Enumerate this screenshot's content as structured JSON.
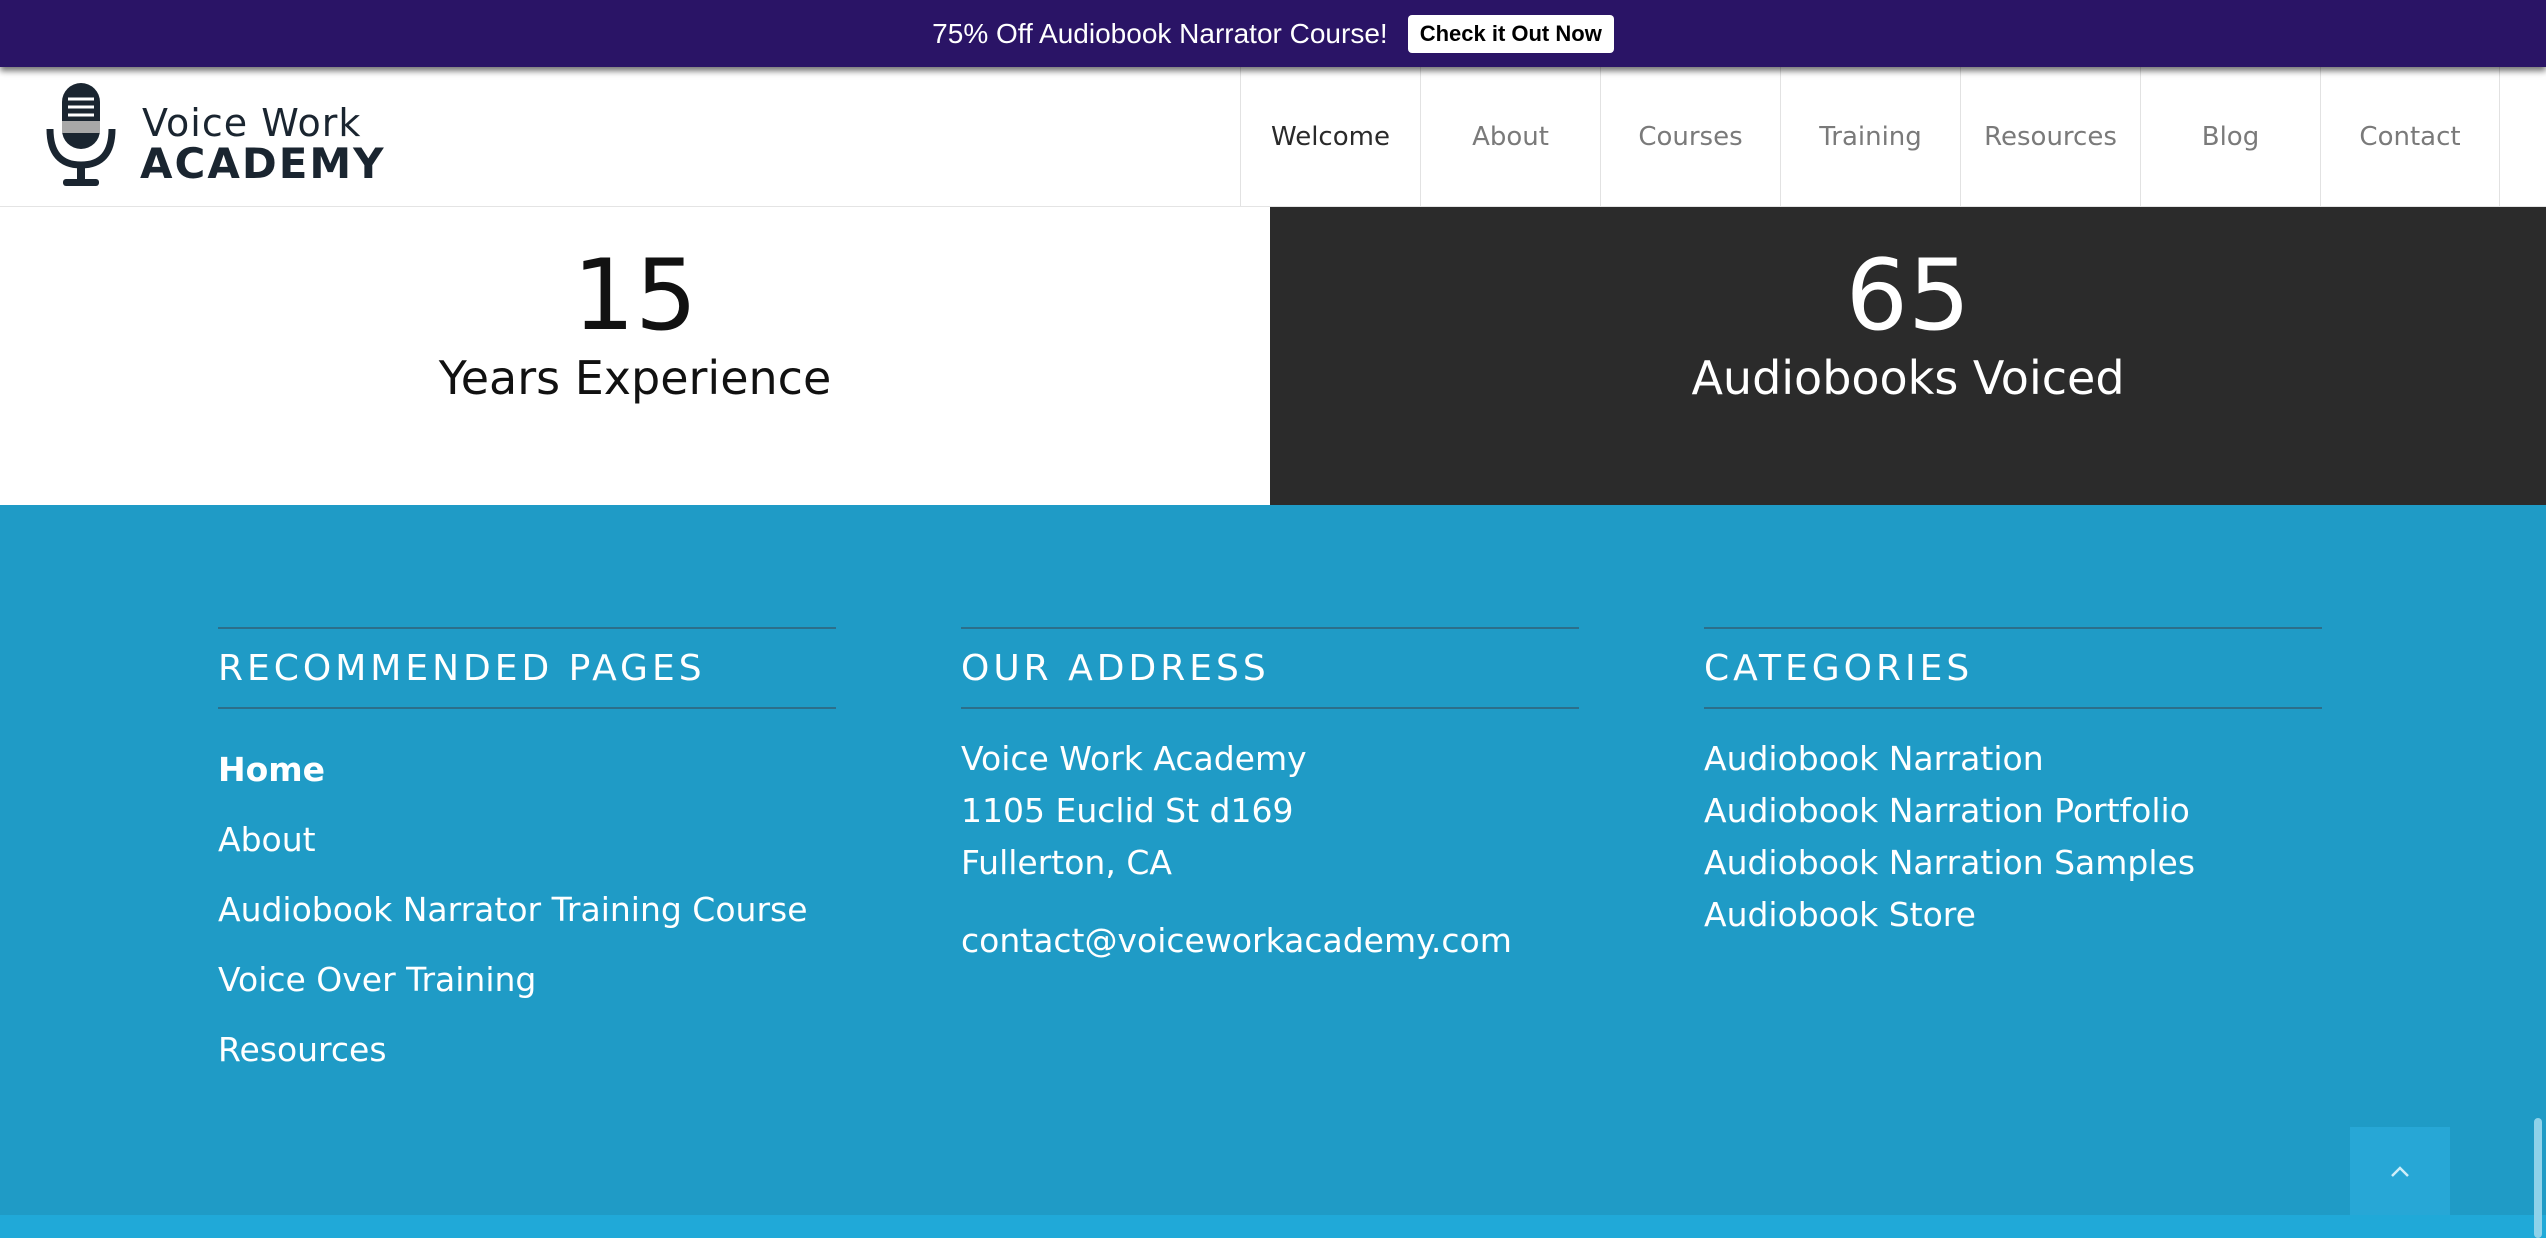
{
  "promo": {
    "text": "75% Off Audiobook Narrator Course!",
    "button_label": "Check it Out Now"
  },
  "header": {
    "logo": {
      "line1": "Voice Work",
      "line2": "ACADEMY"
    },
    "nav": [
      {
        "label": "Welcome",
        "active": true
      },
      {
        "label": "About"
      },
      {
        "label": "Courses"
      },
      {
        "label": "Training"
      },
      {
        "label": "Resources"
      },
      {
        "label": "Blog"
      },
      {
        "label": "Contact"
      }
    ]
  },
  "stats": [
    {
      "number": "15",
      "label": "Years Experience"
    },
    {
      "number": "65",
      "label": "Audiobooks Voiced"
    }
  ],
  "footer": {
    "recommended": {
      "title": "RECOMMENDED PAGES",
      "links": [
        "Home",
        "About",
        "Audiobook Narrator Training Course",
        "Voice Over Training",
        "Resources"
      ]
    },
    "address": {
      "title": "OUR ADDRESS",
      "lines": [
        "Voice Work Academy",
        "1105 Euclid St d169",
        "Fullerton, CA"
      ],
      "email": "contact@voiceworkacademy.com"
    },
    "categories": {
      "title": "CATEGORIES",
      "links": [
        "Audiobook Narration",
        "Audiobook Narration Portfolio",
        "Audiobook Narration Samples",
        "Audiobook Store"
      ]
    }
  },
  "icons": {
    "logo": "microphone-icon",
    "back_to_top": "chevron-up-icon"
  },
  "colors": {
    "promo_bg": "#2a1466",
    "footer_bg": "#1f9bc6",
    "dark_stat_bg": "#2b2b2b"
  }
}
